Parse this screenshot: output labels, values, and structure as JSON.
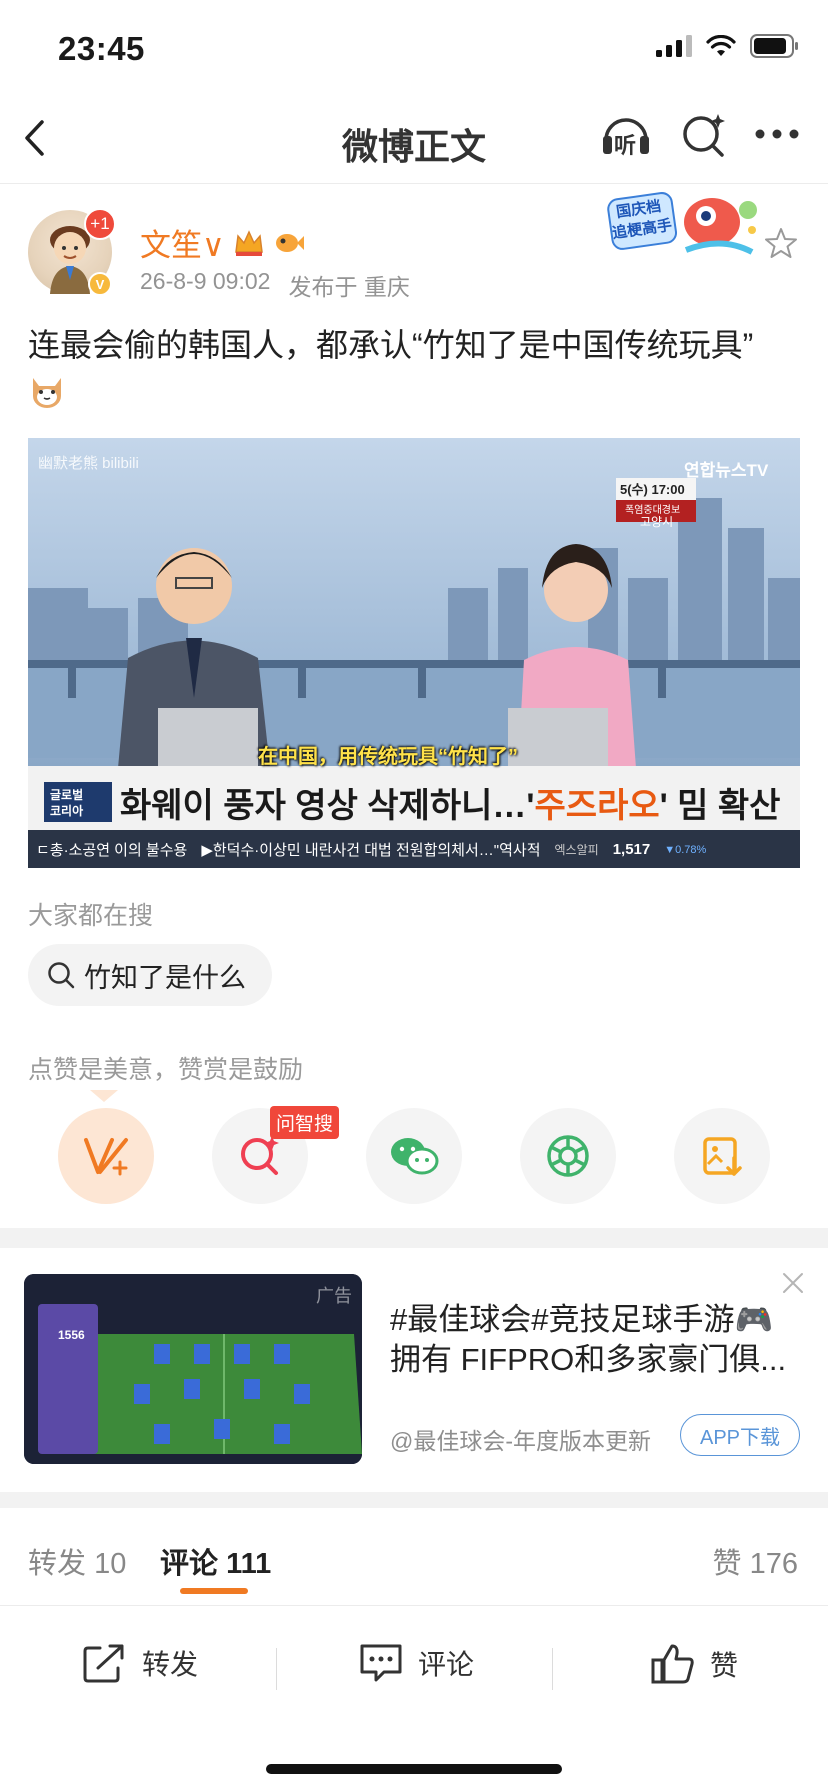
{
  "status_bar": {
    "time": "23:45"
  },
  "nav": {
    "title": "微博正文",
    "listen_label": "听"
  },
  "post": {
    "author": "文笙∨",
    "avatar_badge": "+1",
    "date": "26-8-9 09:02",
    "location": "发布于 重庆",
    "text": "连最会偷的韩国人，都承认“竹知了是中国传统玩具”",
    "promo_line1": "国庆档",
    "promo_line2": "追梗高手"
  },
  "video": {
    "watermark": "幽默老熊 bilibili",
    "channel": "연합뉴스TV",
    "date_time": "5(수) 17:00",
    "alert": "폭염중대경보",
    "region": "고양시",
    "subtitle": "在中国，用传统玩具“竹知了”",
    "tag_line1": "글로벌",
    "tag_line2": "코리아",
    "headline_pre": "화웨이 풍자 영상 삭제하니…'",
    "headline_hl": "주즈라오",
    "headline_post": "' 밈 확산",
    "ticker_left": "ㄷ총·소공연 이의 불수용",
    "ticker_mid": "▶한덕수·이상민 내란사건 대법 전원합의체서…\"역사적",
    "ticker_label": "엑스알피",
    "ticker_value": "1,517",
    "ticker_change": "▼0.78%"
  },
  "search": {
    "section_label": "大家都在搜",
    "chip": "竹知了是什么"
  },
  "reward": {
    "section_label": "点赞是美意，赞赏是鼓励",
    "ask_badge": "问智搜"
  },
  "ad": {
    "label": "广告",
    "text": "#最佳球会#竞技足球手游🎮拥有 FIFPRO和多家豪门俱...",
    "source": "@最佳球会-年度版本更新",
    "button": "APP下载",
    "thumb_score": "1556"
  },
  "tabs": {
    "repost": "转发",
    "repost_count": "10",
    "comment": "评论",
    "comment_count": "111",
    "like": "赞",
    "like_count": "176"
  },
  "bottom_bar": {
    "repost": "转发",
    "comment": "评论",
    "like": "赞"
  },
  "colors": {
    "accent_orange": "#f07a23",
    "link_blue": "#5a95d8",
    "badge_red": "#f0473a"
  }
}
